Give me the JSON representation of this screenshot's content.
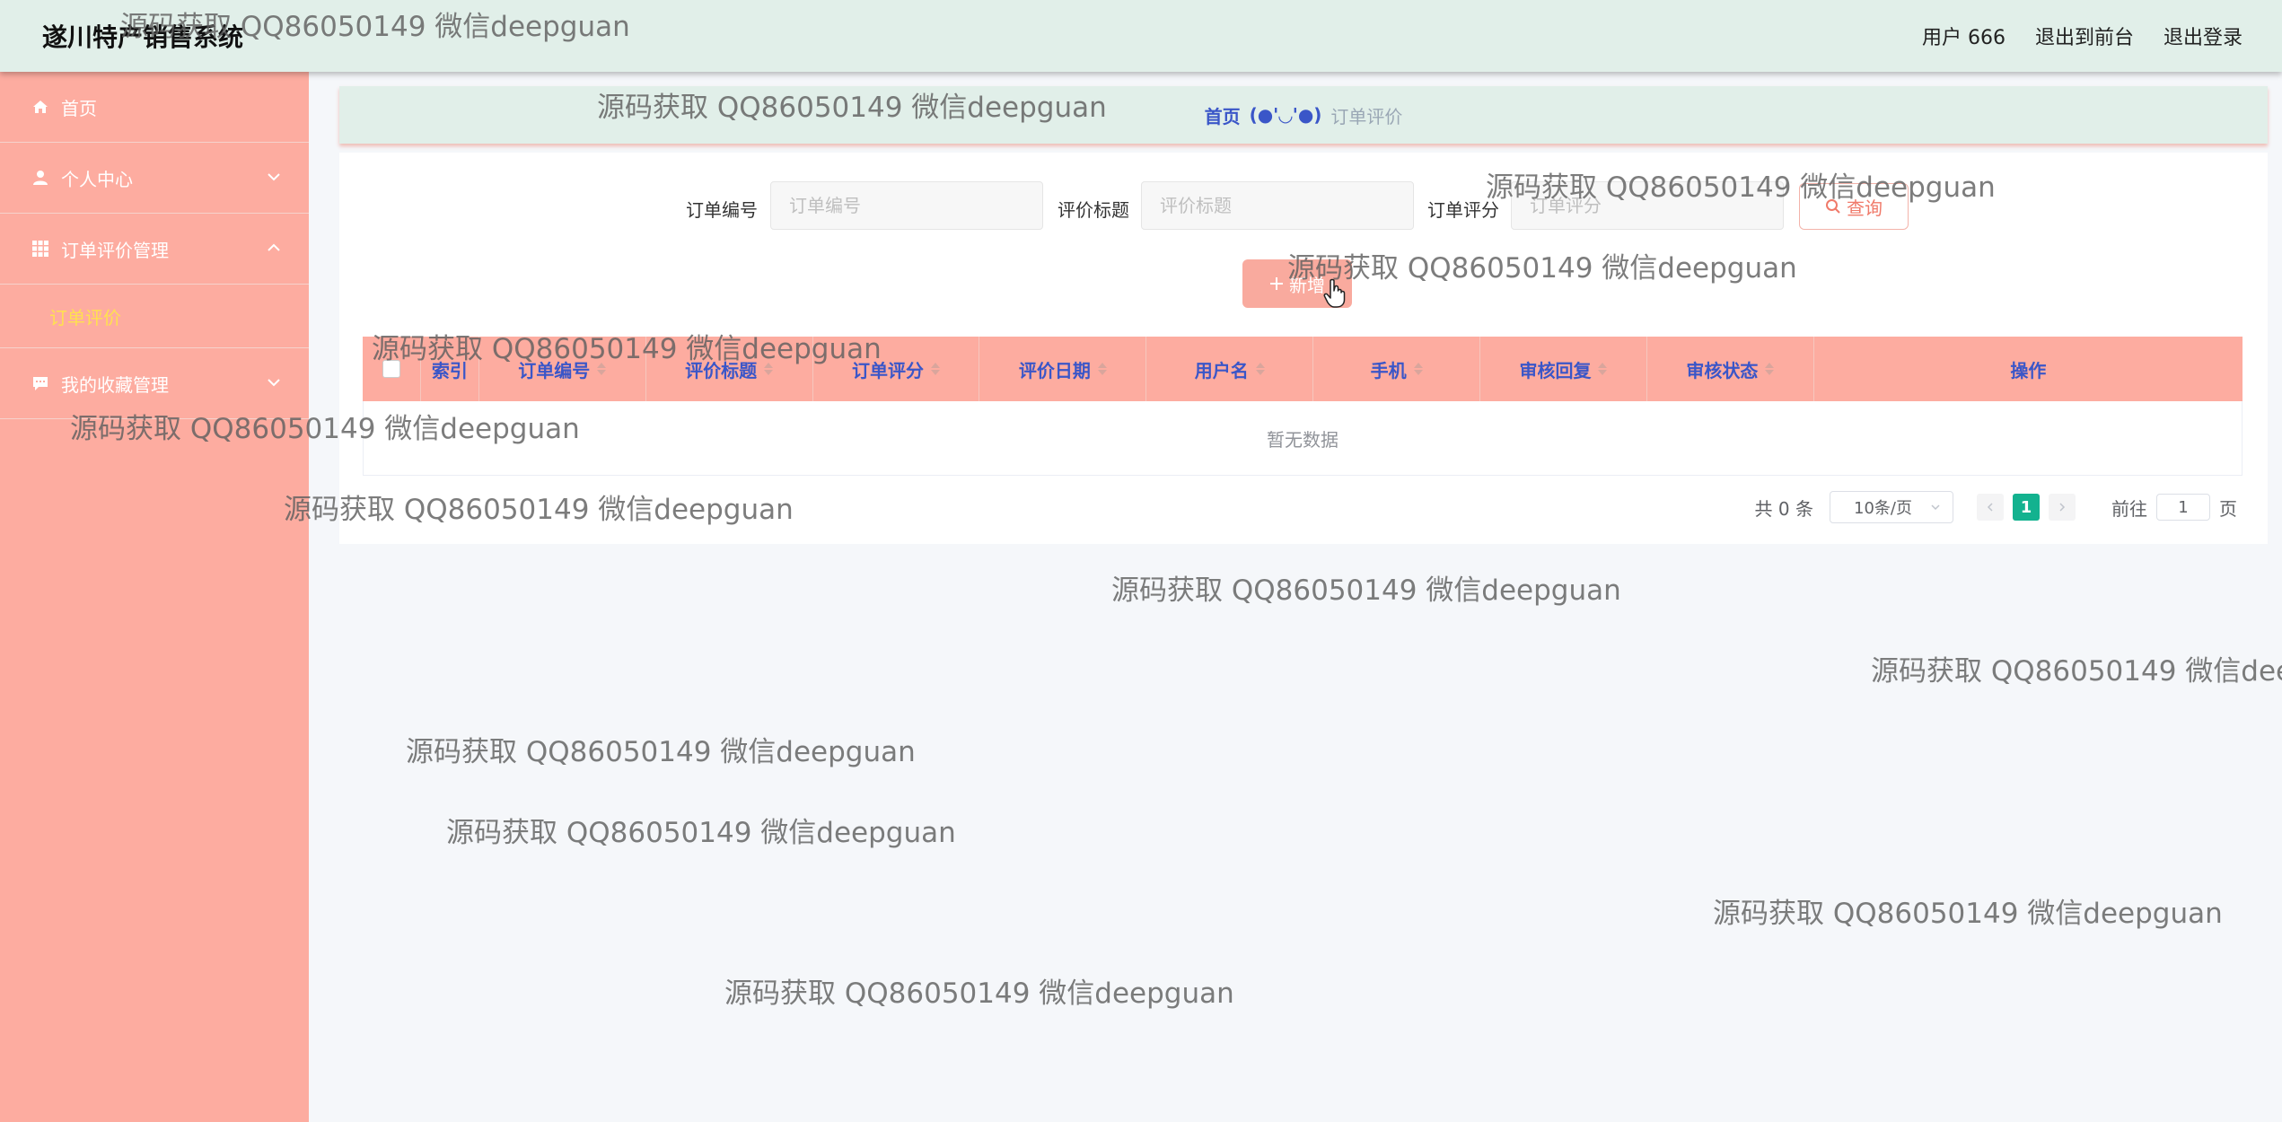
{
  "header": {
    "app_title": "遂川特产销售系统",
    "user_label": "用户 666",
    "back_to_front": "退出到前台",
    "logout": "退出登录"
  },
  "sidebar": {
    "items": [
      {
        "label": "首页",
        "icon": "home-icon"
      },
      {
        "label": "个人中心",
        "icon": "user-icon"
      },
      {
        "label": "订单评价管理",
        "icon": "grid-icon"
      },
      {
        "label": "订单评价",
        "active": true
      },
      {
        "label": "我的收藏管理",
        "icon": "chat-icon"
      }
    ]
  },
  "breadcrumb": {
    "home": "首页",
    "separator": "(●'◡'●)",
    "current": "订单评价"
  },
  "search": {
    "order_no_label": "订单编号",
    "order_no_placeholder": "订单编号",
    "title_label": "评价标题",
    "title_placeholder": "评价标题",
    "score_label": "订单评分",
    "score_placeholder": "订单评分",
    "query_button": "查询"
  },
  "actions": {
    "add_button": "新增"
  },
  "table": {
    "columns": [
      "索引",
      "订单编号",
      "评价标题",
      "订单评分",
      "评价日期",
      "用户名",
      "手机",
      "审核回复",
      "审核状态",
      "操作"
    ],
    "empty_text": "暂无数据"
  },
  "pagination": {
    "total": "共 0 条",
    "page_size": "10条/页",
    "current_page": "1",
    "goto_prefix": "前往",
    "goto_value": "1",
    "goto_suffix": "页"
  },
  "watermark": "源码获取 QQ86050149 微信deepguan",
  "colors": {
    "header_bg": "#e1efe9",
    "sidebar_bg": "#fdaca0",
    "accent_text": "#3a56c8",
    "active_menu": "#ffe14f",
    "page_active": "#13b28f"
  }
}
